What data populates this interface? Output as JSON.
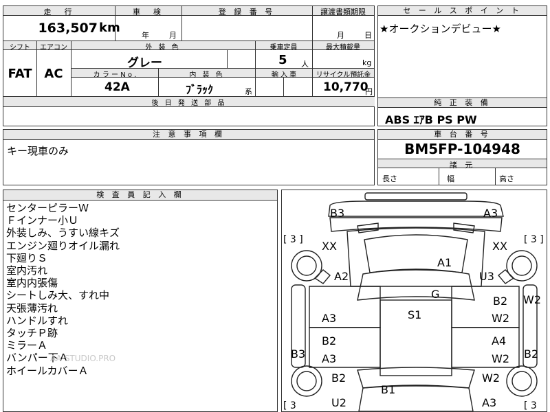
{
  "top": {
    "mileage_label": "走　行",
    "mileage_value": "163,507",
    "mileage_unit": "km",
    "inspection_label": "車　検",
    "inspection_year": "年",
    "inspection_month": "月",
    "registration_label": "登 録 番 号",
    "transfer_label": "譲渡書類期限",
    "transfer_month": "月",
    "transfer_day": "日"
  },
  "specs": {
    "shift_label": "シフト",
    "shift_value": "FAT",
    "aircon_label": "エアコン",
    "aircon_value": "AC",
    "exterior_label": "外 装 色",
    "exterior_value": "グレー",
    "capacity_label": "乗車定員",
    "capacity_value": "5",
    "capacity_unit": "人",
    "maxload_label": "最大積載量",
    "maxload_unit": "kg",
    "color_no_label": "カ ラ ー N o .",
    "color_no_value": "42A",
    "interior_label": "内 装 色",
    "interior_value": "ﾌﾞﾗｯｸ",
    "interior_unit": "系",
    "import_label": "輸 入 車",
    "recycle_label": "リサイクル預託金",
    "recycle_value": "10,770",
    "recycle_unit": "円",
    "delivery_label": "後 日 発 送 部 品"
  },
  "sales_point": {
    "label": "セ ー ル ス ポ イ ン ト",
    "value": "★オークションデビュー★"
  },
  "equipment": {
    "label": "純 正 装 備",
    "value": "ABS ｴｱB PS PW"
  },
  "caution": {
    "label": "注 意 事 項 欄",
    "value": "キー現車のみ"
  },
  "chassis": {
    "label": "車 台 番 号",
    "value": "BM5FP-104948",
    "dims_label": "諸 元",
    "length": "長さ",
    "width": "幅",
    "height": "高さ"
  },
  "inspector": {
    "label": "検 査 員 記 入 欄",
    "notes": [
      "センターピラーＷ",
      "Ｆインナー小Ｕ",
      "外装しみ、うすい線キズ",
      "エンジン廻りオイル漏れ",
      "下廻りＳ",
      "室内汚れ",
      "室内内張傷",
      "シートしみ大、すれ中",
      "天張薄汚れ",
      "ハンドルすれ",
      "タッチＰ跡",
      "ミラーＡ",
      "バンパー下Ａ",
      "ホイールカバーＡ"
    ],
    "watermark": "AA-STUDIO.PRO"
  },
  "diagram": {
    "tire_left": "[ 3 ]",
    "tire_right": "[ 3 ]",
    "tire_left_bottom": "[ 3",
    "tire_right_bottom": "[ 3",
    "marks": {
      "b3_top": "B3",
      "a3_top": "A3",
      "xx_left": "XX",
      "xx_right": "XX",
      "a1": "A1",
      "a2": "A2",
      "u3": "U3",
      "g": "G",
      "b2_rf": "B2",
      "w2_rf": "W2",
      "w2_right": "W2",
      "a3_lf": "A3",
      "s1": "S1",
      "b2_lr": "B2",
      "a3_lr": "A3",
      "a4": "A4",
      "w2_rr": "W2",
      "b3_left": "B3",
      "b2_right": "B2",
      "b2_lower": "B2",
      "w2_lower": "W2",
      "b1": "B1",
      "u2": "U2",
      "a3_bottom": "A3"
    }
  }
}
